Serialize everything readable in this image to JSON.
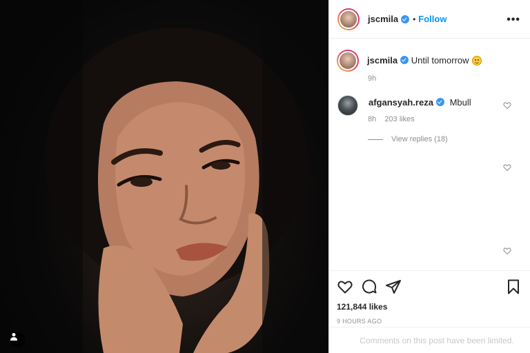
{
  "post": {
    "author": {
      "username": "jscmila",
      "verified": true,
      "follow_label": "Follow"
    },
    "more_icon": "more-horizontal-icon",
    "caption": {
      "username": "jscmila",
      "text": "Until tomorrow",
      "emoji_icon": "smiley-emoji-icon",
      "time": "9h"
    },
    "comments": [
      {
        "username": "afgansyah.reza",
        "verified": true,
        "text": "Mbull",
        "time": "8h",
        "likes": "203 likes",
        "view_replies": "View replies (18)"
      }
    ],
    "actions": {
      "like_icon": "heart-icon",
      "comment_icon": "comment-bubble-icon",
      "share_icon": "paper-plane-icon",
      "save_icon": "bookmark-icon"
    },
    "likes_count": "121,844 likes",
    "posted_ago": "9 HOURS AGO",
    "comments_notice": "Comments on this post have been limited."
  },
  "colors": {
    "link_blue": "#0095f6",
    "verified_blue": "#3897f0",
    "muted_text": "#8e8e8e",
    "border": "#efefef"
  }
}
